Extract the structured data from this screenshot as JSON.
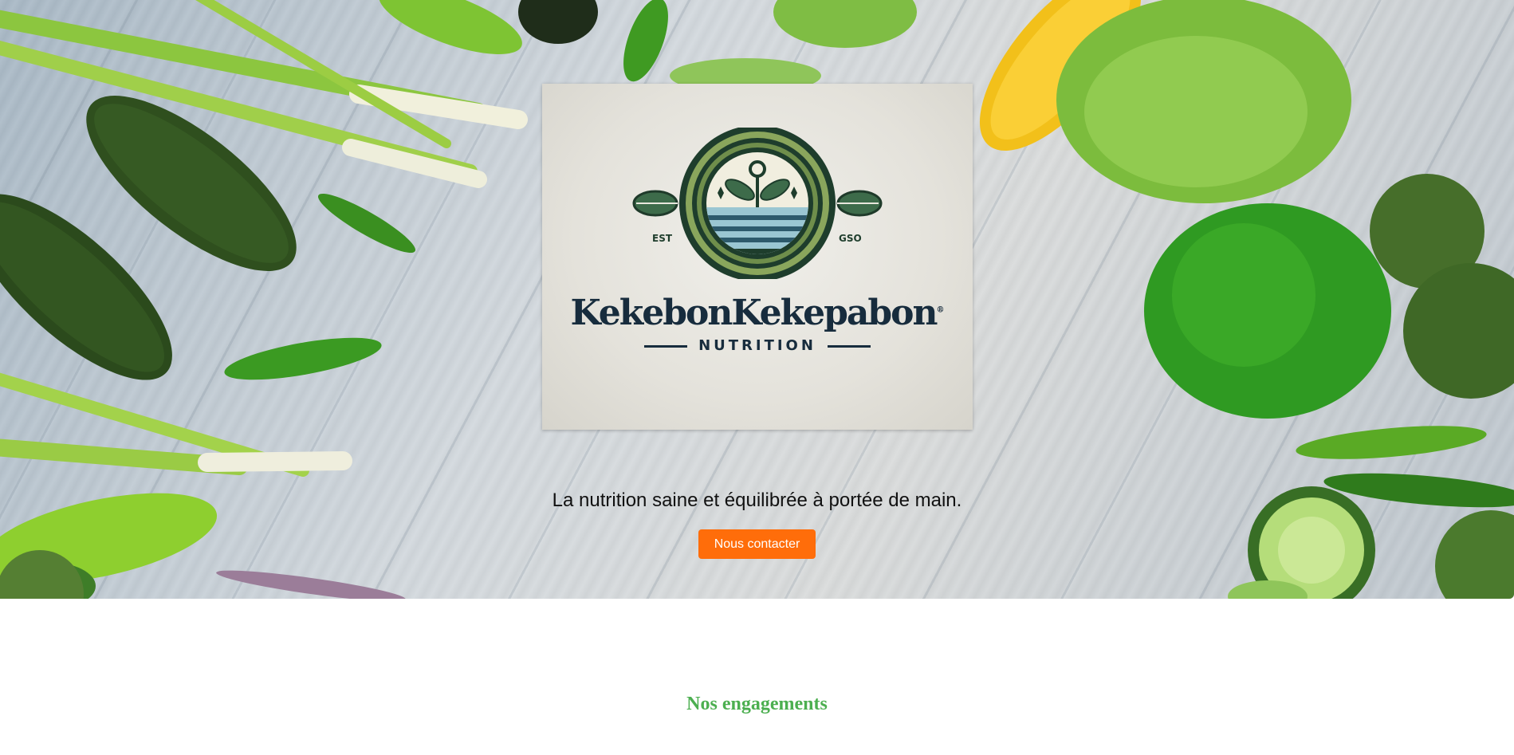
{
  "hero": {
    "background_image": "vegetables-on-wooden-table",
    "tagline": "La nutrition saine et équilibrée à portée de main.",
    "cta_label": "Nous contacter",
    "cta_color": "#ff6d0a"
  },
  "logo": {
    "emblem_icon": "sprout-horizon-icon",
    "est_left": "EST",
    "est_right": "GSO",
    "brand_name": "KekebonKekepabon",
    "brand_sub": "NUTRITION",
    "trademark": "®"
  },
  "engagements": {
    "title": "Nos engagements",
    "accent_color": "#4caf50"
  }
}
